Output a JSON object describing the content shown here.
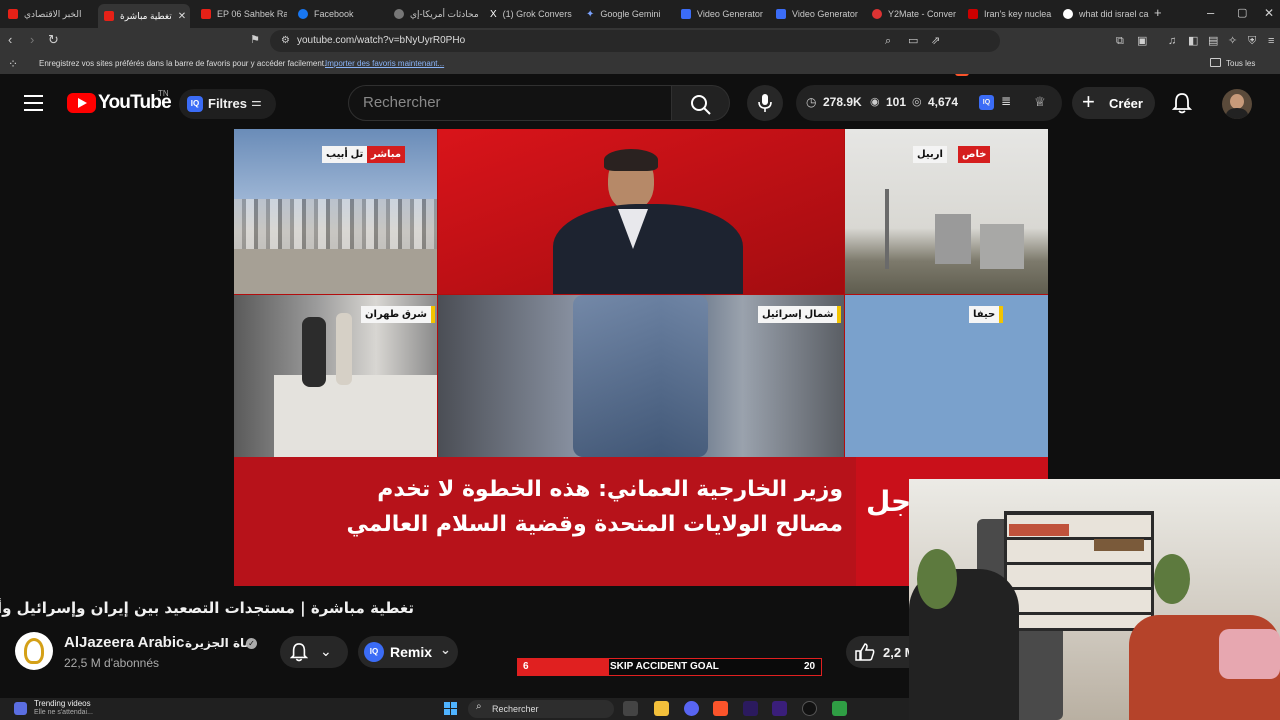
{
  "browser": {
    "tabs": [
      {
        "label": "الخبر الاقتصادي",
        "color": "#e62117"
      },
      {
        "label": "تغطية مباشرة",
        "color": "#e62117",
        "active": true
      },
      {
        "label": "EP 06 Sahbek Ra",
        "color": "#e62117"
      },
      {
        "label": "Facebook",
        "color": "#1877f2"
      },
      {
        "label": "محادثات أمريكا-إي",
        "color": "#777777"
      },
      {
        "label": "(1) Grok Convers",
        "color": "#ffffff"
      },
      {
        "label": "Google Gemini",
        "color": "#7aa2ff"
      },
      {
        "label": "Video Generator",
        "color": "#3b6cf6"
      },
      {
        "label": "Video Generator",
        "color": "#3b6cf6"
      },
      {
        "label": "Y2Mate - Conver",
        "color": "#d33"
      },
      {
        "label": "Iran's key nuclea",
        "color": "#c00"
      },
      {
        "label": "what did israel ca",
        "color": "#ffffff"
      }
    ],
    "url": "youtube.com/watch?v=bNyUyrR0PHo",
    "bookmarks_prompt": "Enregistrez vos sites préférés dans la barre de favoris pour y accéder facilement.",
    "bookmarks_link": "Importer des favoris maintenant...",
    "bookmarks_all": "Tous les favoris"
  },
  "youtube": {
    "logo_text": "YouTube",
    "logo_region": "TN",
    "filters_label": "Filtres",
    "search_placeholder": "Rechercher",
    "stats": {
      "time": "278.9K",
      "views": "101",
      "eye_count": "4,674"
    },
    "create_label": "Créer"
  },
  "video": {
    "tags": {
      "live": "مباشر",
      "telaviv": "تل أبيب",
      "exclusive": "خاص",
      "erbil": "اربيل",
      "east_tehran": "شرق طهران",
      "north_israel": "شمال إسرائيل",
      "haifa": "حيفا"
    },
    "ticker_line1": "وزير الخارجية العماني: هذه الخطوة لا تخدم",
    "ticker_line2": "مصالح الولايات المتحدة وقضية السلام العالمي",
    "urgent_fragment": "جل"
  },
  "watch": {
    "title": "تغطية مباشرة | مستجدات التصعيد بين إيران وإسرائيل وأمريكا",
    "channel_name": "AlJazeera Arabic",
    "channel_name_ar": "قناة الجزيرة",
    "subscribers": "22,5 M d'abonnés",
    "remix_label": "Remix",
    "likes": "2,2 M"
  },
  "overlay": {
    "left_value": "6",
    "label": "SKIP ACCIDENT GOAL",
    "right_value": "20",
    "progress_fraction": 0.3
  },
  "taskbar": {
    "widget_title": "Trending videos",
    "widget_sub": "Elle ne s'attendai...",
    "search_label": "Rechercher"
  }
}
